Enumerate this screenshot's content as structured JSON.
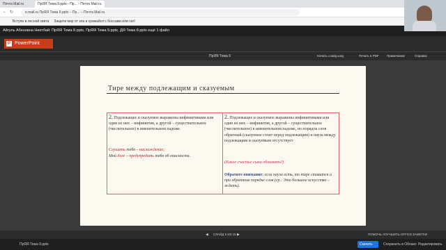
{
  "browser": {
    "tabs": [
      "Почта Mail.ru",
      "ПрЯЯ Тема 9.pptx - Пр... - Почта Mail.ru"
    ],
    "url": "e.mail.ru   ПрЯЯ Тема 9.pptx – Пр... – Почта Mail.ru",
    "bookmarks": [
      "Вступи в лесной свята",
      "Защити мир от зла и сражайся с боссами или гал!"
    ],
    "files_line": "Айгуль Абеновна Ниетбай: ПрЯЯ Тема 8.pptx, ПрЯЯ Тема 9.pptx, ДЯ Тема 8.pptx ещё 1 файл"
  },
  "powerpoint": {
    "app_name": "PowerPoint",
    "file_name": "ПрЯЯ Тема 9",
    "toolbar": {
      "start_show": "Начать слайд-шоу",
      "open_pdf": "Печать в PDF",
      "notes": "Примечание",
      "help": "Справка"
    },
    "status": {
      "slide_counter": "СЛАЙД 5 ИЗ 15",
      "improve": "ПОМОЧЬ УЛУЧШИТЬ OFFICE",
      "notes": "ЗАМЕТКИ"
    }
  },
  "slide": {
    "title": "Тире  между  подлежащим  и  сказуемым",
    "left": {
      "num": "2.",
      "rule": "Подлежащее и сказуемое выражены инфинитивами или один из них – инфинитив, а другой – существительное (числительное) в именительном падеже.",
      "ex1_a": "Слушать",
      "ex1_b": " тебя – ",
      "ex1_c": "наслаждение",
      "ex1_d": ";",
      "ex2_a": "Мой ",
      "ex2_b": "долг",
      "ex2_c": " – ",
      "ex2_d": "предупредить",
      "ex2_e": " тебя об опасности."
    },
    "right": {
      "num": "2.",
      "rule": "Подлежащее и сказуемое выражены инфинитивами или один из них – инфинитив, а другой – существительное (числительное) в именительном падеже, но порядок слов обратный (сказуемое стоит перед подлежащим) и пауза между подлежащим и сказуемым отсутствует",
      "example": "(Какое счастье сына обнимать!)",
      "note_label": "Обратите внимание:",
      "note": " если пауза есть, то тире ставится и при обратном порядке слов (ср.: Это большое искусство – ждать)."
    }
  },
  "taskbar": {
    "left_text": "ПрЯЯ Тема 9.pptx",
    "download": "Скачать",
    "save_cloud": "Сохранить в Облако",
    "edit": "Редактировать"
  },
  "colors": {
    "accent": "#c43e1c",
    "table_border": "#dd6666",
    "slide_bg": "#fcf9f0"
  }
}
